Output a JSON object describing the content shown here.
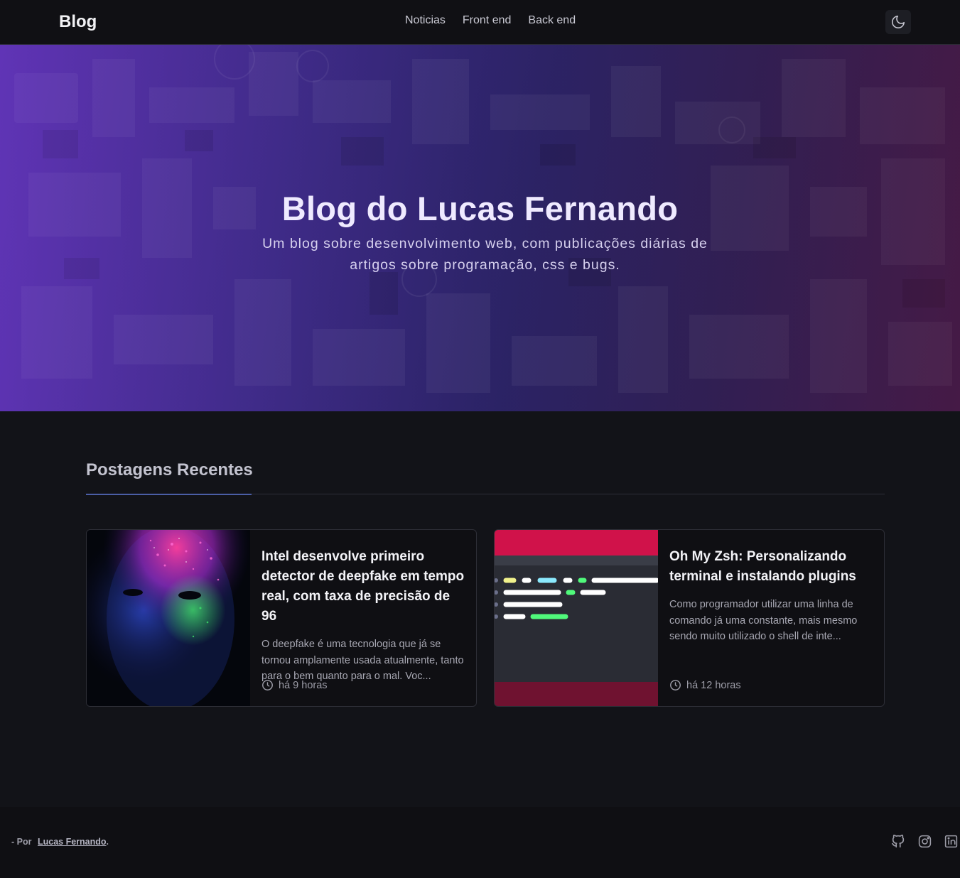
{
  "header": {
    "brand": "Blog",
    "nav": [
      "Noticias",
      "Front end",
      "Back end"
    ],
    "theme_toggle_icon": "moon-icon"
  },
  "hero": {
    "title": "Blog do Lucas Fernando",
    "subtitle": "Um blog sobre desenvolvimento web, com publicações diárias de artigos sobre programação, css e bugs."
  },
  "recent": {
    "title": "Postagens Recentes",
    "posts": [
      {
        "title": "Intel desenvolve primeiro detector de deepfake em tempo real, com taxa de precisão de 96",
        "excerpt": "O deepfake é uma tecnologia que já se tornou amplamente usada atualmente, tanto para o bem quanto para o mal. Voc...",
        "time": "há 9 horas",
        "image": "face-with-colored-paint-image"
      },
      {
        "title": "Oh My Zsh: Personalizando terminal e instalando plugins",
        "excerpt": "Como programador utilizar uma linha de comando já uma constante, mais mesmo sendo muito utilizado o shell de inte...",
        "time": "há 12 horas",
        "image": "terminal-illustration-image"
      }
    ]
  },
  "footer": {
    "prefix": "- Por",
    "author": "Lucas Fernando",
    "suffix": ".",
    "social": [
      "github-icon",
      "instagram-icon",
      "linkedin-icon"
    ]
  },
  "colors": {
    "background": "#121318",
    "accent": "#4b5ea6",
    "hero_purple": "#3d2a86"
  }
}
